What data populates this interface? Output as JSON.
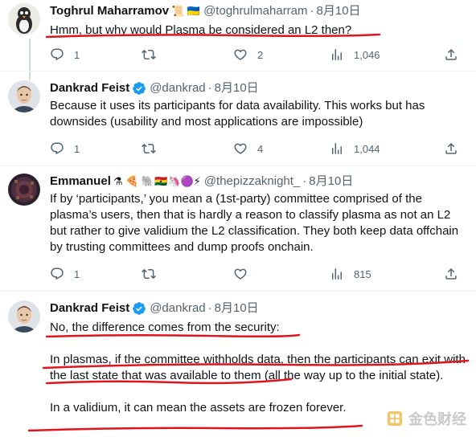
{
  "tweets": [
    {
      "name": "Toghrul Maharramov",
      "badges": "📜 🇺🇦",
      "handle": "@toghrulmaharram",
      "date": "8月10日",
      "text": "Hmm, but why would Plasma be considered an L2 then?",
      "replies": "1",
      "likes": "2",
      "views": "1,046"
    },
    {
      "name": "Dankrad Feist",
      "handle": "@dankrad",
      "date": "8月10日",
      "text": "Because it uses its participants for data availability. This works but has downsides (usability and most applications are impossible)",
      "replies": "1",
      "likes": "4",
      "views": "1,044"
    },
    {
      "name": "Emmanuel",
      "badges": "⚗ 🍕 🐘🇬🇭🦄🟣⚡",
      "handle": "@thepizzaknight_",
      "date": "8月10日",
      "text": "If by ‘participants,’ you mean a (1st-party) committee comprised of the plasma’s users, then that is hardly a reason to classify plasma as not an L2 but rather to give validium the L2 classification. They both keep data offchain by trusting committees and dump proofs onchain.",
      "replies": "1",
      "views": "815"
    },
    {
      "name": "Dankrad Feist",
      "handle": "@dankrad",
      "date": "8月10日",
      "text_1": "No, the difference comes from the security:",
      "text_2": "In plasmas, if the committee withholds data, then the participants can exit with the last state that was available to them (all the way up to the initial state).",
      "text_3": "In a validium, it can mean the assets are frozen forever."
    }
  ],
  "separator": "·",
  "watermark": "金色财经",
  "colors": {
    "accent": "#1d9bf0",
    "muted": "#536471",
    "annotation": "#e0141e"
  }
}
